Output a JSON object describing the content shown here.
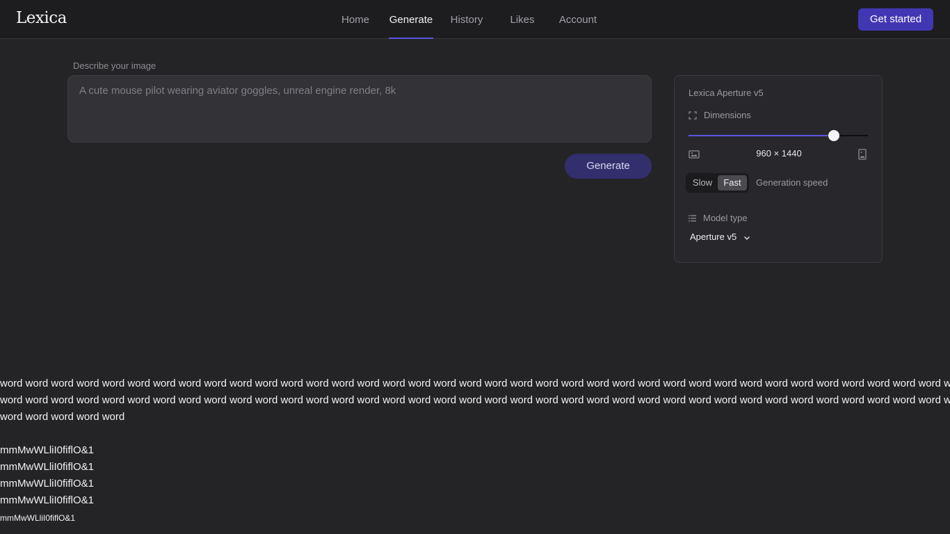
{
  "header": {
    "logo": "Lexica",
    "nav": [
      {
        "label": "Home",
        "active": false
      },
      {
        "label": "Generate",
        "active": true
      },
      {
        "label": "History",
        "active": false
      },
      {
        "label": "Likes",
        "active": false
      },
      {
        "label": "Account",
        "active": false
      }
    ],
    "cta_label": "Get started"
  },
  "prompt": {
    "label": "Describe your image",
    "placeholder": "A cute mouse pilot wearing aviator goggles, unreal engine render, 8k",
    "value": "",
    "generate_label": "Generate"
  },
  "settings": {
    "title": "Lexica Aperture v5",
    "dimensions_label": "Dimensions",
    "dimensions_value": "960 × 1440",
    "slider_fraction": 0.81,
    "speed_options": [
      "Slow",
      "Fast"
    ],
    "speed_selected": "Fast",
    "speed_label": "Generation speed",
    "model_type_label": "Model type",
    "model_selected": "Aperture v5"
  },
  "font_test": {
    "words": "word word word word word word word word word word word word word word word word word word word word word word word word word word word word word word word word word word word word word word word word word word word word word word word word word word word word word word word word word word word word word word word word word word word word word word word word word word word word word word word word word",
    "samples": [
      "mmMwWLliI0fiflO&1",
      "mmMwWLliI0fiflO&1",
      "mmMwWLliI0fiflO&1",
      "mmMwWLliI0fiflO&1",
      "mmMwWLliI0fiflO&1"
    ]
  },
  "colors": {
    "background": "#242427",
    "header": "#1d1d20",
    "accent": "#5b56e0",
    "cta": "#4237b3",
    "generate_button": "#332f6d"
  },
  "icons": [
    "expand-icon",
    "landscape-image-icon",
    "portrait-image-icon",
    "list-icon",
    "chevron-down-icon"
  ]
}
